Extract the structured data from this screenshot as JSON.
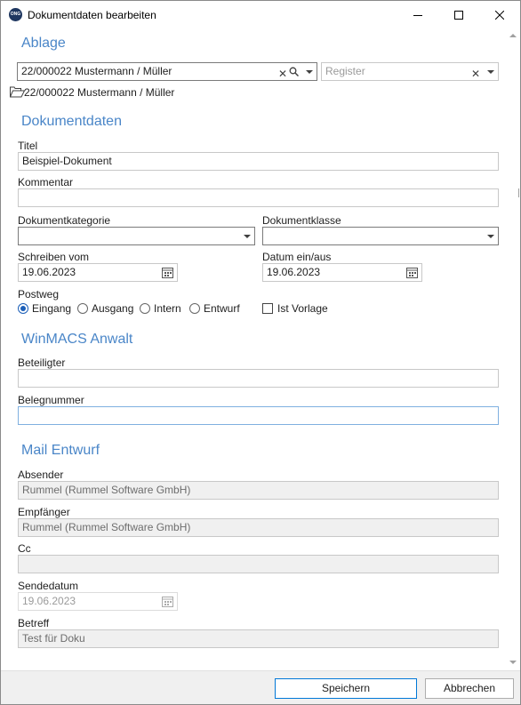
{
  "window": {
    "title": "Dokumentdaten bearbeiten",
    "icon_label": "ONG"
  },
  "ablage": {
    "heading": "Ablage",
    "akte_value": "22/000022 Mustermann / Müller",
    "register_placeholder": "Register",
    "folder_path": "22/000022 Mustermann / Müller"
  },
  "dokumentdaten": {
    "heading": "Dokumentdaten",
    "titel_label": "Titel",
    "titel_value": "Beispiel-Dokument",
    "kommentar_label": "Kommentar",
    "kommentar_value": "",
    "kategorie_label": "Dokumentkategorie",
    "kategorie_value": "",
    "klasse_label": "Dokumentklasse",
    "klasse_value": "",
    "schreiben_label": "Schreiben vom",
    "schreiben_value": "19.06.2023",
    "datum_label": "Datum ein/aus",
    "datum_value": "19.06.2023",
    "postweg_label": "Postweg",
    "postweg_options": [
      "Eingang",
      "Ausgang",
      "Intern",
      "Entwurf"
    ],
    "postweg_selected": "Eingang",
    "vorlage_label": "Ist Vorlage",
    "vorlage_checked": false
  },
  "winmacs": {
    "heading": "WinMACS Anwalt",
    "beteiligter_label": "Beteiligter",
    "beteiligter_value": "",
    "belegnummer_label": "Belegnummer",
    "belegnummer_value": ""
  },
  "mail": {
    "heading": "Mail Entwurf",
    "absender_label": "Absender",
    "absender_value": "Rummel (Rummel Software GmbH)",
    "empfaenger_label": "Empfänger",
    "empfaenger_value": "Rummel (Rummel Software GmbH)",
    "cc_label": "Cc",
    "cc_value": "",
    "sendedatum_label": "Sendedatum",
    "sendedatum_value": "19.06.2023",
    "betreff_label": "Betreff",
    "betreff_value": "Test für Doku"
  },
  "footer": {
    "save_label": "Speichern",
    "cancel_label": "Abbrechen"
  },
  "colors": {
    "heading": "#4a86c8",
    "accent": "#0078d7",
    "radio_selected": "#1c5fb8",
    "disabled_bg": "#f0f0f0"
  }
}
